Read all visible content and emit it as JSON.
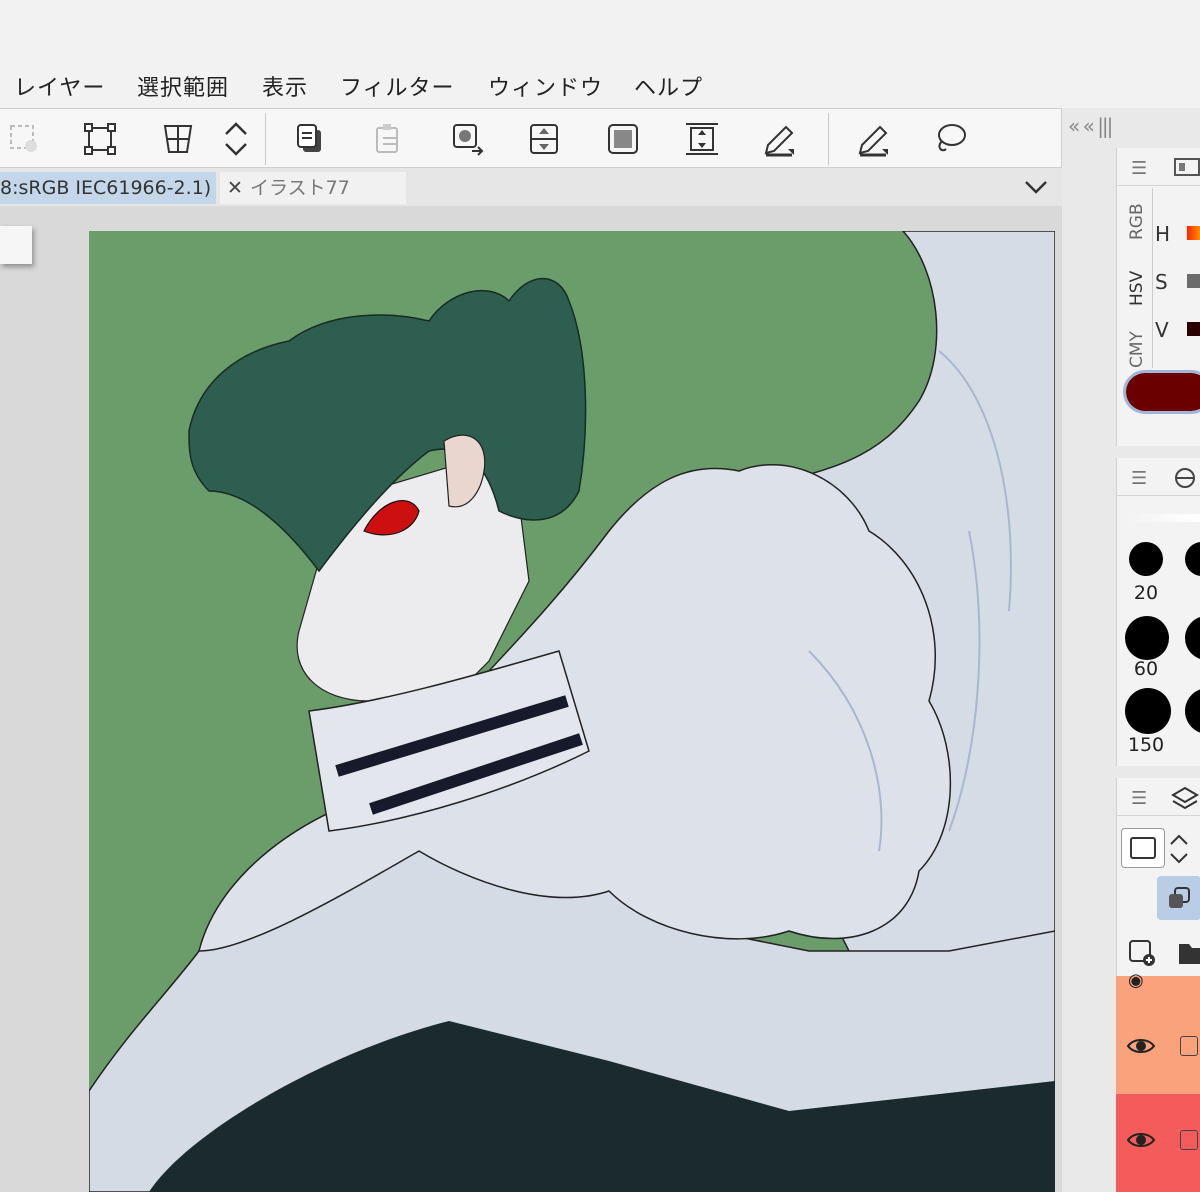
{
  "menu": [
    "レイヤー",
    "選択範囲",
    "表示",
    "フィルター",
    "ウィンドウ",
    "ヘルプ"
  ],
  "tabs": {
    "active": "8:sRGB IEC61966-2.1)",
    "inactive": "イラスト77",
    "close_glyph": "✕"
  },
  "right_column": {
    "collapse_label": "« « |||"
  },
  "color_panel": {
    "modes": [
      "RGB",
      "HSV",
      "CMY"
    ],
    "labels": [
      "H",
      "S",
      "V"
    ],
    "main_color": "#6b0000"
  },
  "brush_sizes": [
    "20",
    "60",
    "150"
  ],
  "layers": {
    "row_colors": [
      "#f9a27c",
      "#f9a27c",
      "#f45b5b"
    ]
  }
}
